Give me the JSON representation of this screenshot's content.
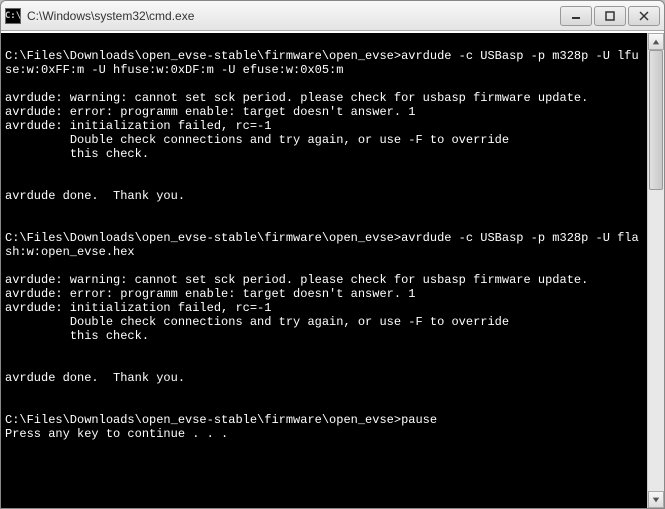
{
  "window": {
    "icon_label": "C:\\",
    "title": "C:\\Windows\\system32\\cmd.exe"
  },
  "terminal": {
    "lines": [
      "",
      "C:\\Files\\Downloads\\open_evse-stable\\firmware\\open_evse>avrdude -c USBasp -p m328p -U lfuse:w:0xFF:m -U hfuse:w:0xDF:m -U efuse:w:0x05:m",
      "",
      "avrdude: warning: cannot set sck period. please check for usbasp firmware update.",
      "avrdude: error: programm enable: target doesn't answer. 1",
      "avrdude: initialization failed, rc=-1",
      "         Double check connections and try again, or use -F to override",
      "         this check.",
      "",
      "",
      "avrdude done.  Thank you.",
      "",
      "",
      "C:\\Files\\Downloads\\open_evse-stable\\firmware\\open_evse>avrdude -c USBasp -p m328p -U flash:w:open_evse.hex",
      "",
      "avrdude: warning: cannot set sck period. please check for usbasp firmware update.",
      "avrdude: error: programm enable: target doesn't answer. 1",
      "avrdude: initialization failed, rc=-1",
      "         Double check connections and try again, or use -F to override",
      "         this check.",
      "",
      "",
      "avrdude done.  Thank you.",
      "",
      "",
      "C:\\Files\\Downloads\\open_evse-stable\\firmware\\open_evse>pause",
      "Press any key to continue . . ."
    ]
  }
}
